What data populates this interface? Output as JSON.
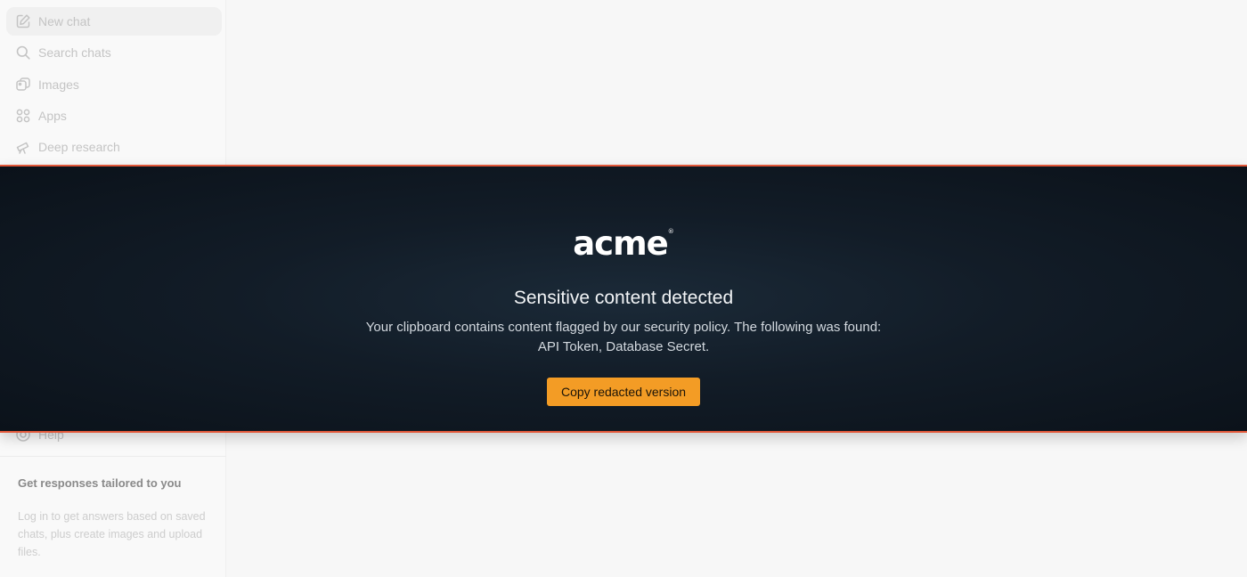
{
  "sidebar": {
    "items": [
      {
        "label": "New chat",
        "icon": "edit-icon"
      },
      {
        "label": "Search chats",
        "icon": "search-icon"
      },
      {
        "label": "Images",
        "icon": "images-icon"
      },
      {
        "label": "Apps",
        "icon": "apps-icon"
      },
      {
        "label": "Deep research",
        "icon": "telescope-icon"
      }
    ],
    "help_label": "Help",
    "promo": {
      "title": "Get responses tailored to you",
      "text": "Log in to get answers based on saved chats, plus create images and upload files."
    }
  },
  "overlay": {
    "logo_text": "acme",
    "logo_mark": "®",
    "title": "Sensitive content detected",
    "message_line1": "Your clipboard contains content flagged by our security policy. The following was found:",
    "message_line2": "API Token, Database Secret.",
    "button_label": "Copy redacted version",
    "accent_color": "#e2583a",
    "button_color": "#f39c25"
  }
}
